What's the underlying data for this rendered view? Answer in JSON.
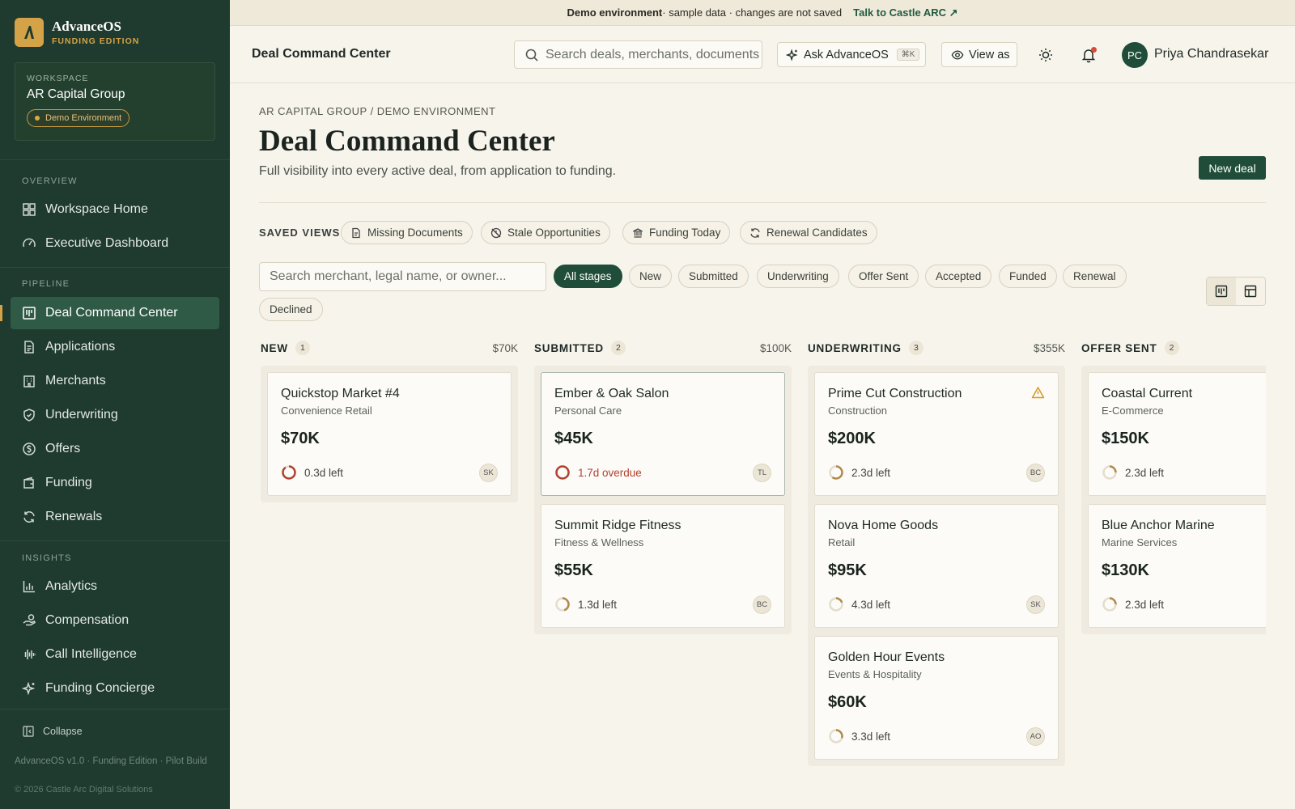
{
  "brand": {
    "name": "AdvanceOS",
    "edition": "FUNDING EDITION"
  },
  "workspace": {
    "label": "WORKSPACE",
    "name": "AR Capital Group",
    "badge": "Demo Environment"
  },
  "nav": {
    "sections": {
      "overview": "OVERVIEW",
      "pipeline": "PIPELINE",
      "insights": "INSIGHTS"
    },
    "items": {
      "workspace_home": "Workspace Home",
      "executive_dashboard": "Executive Dashboard",
      "deal_command_center": "Deal Command Center",
      "applications": "Applications",
      "merchants": "Merchants",
      "underwriting": "Underwriting",
      "offers": "Offers",
      "funding": "Funding",
      "renewals": "Renewals",
      "analytics": "Analytics",
      "compensation": "Compensation",
      "call_intelligence": "Call Intelligence",
      "funding_concierge": "Funding Concierge"
    },
    "collapse": "Collapse",
    "footer": "AdvanceOS v1.0 · Funding Edition · Pilot Build",
    "copyright": "© 2026 Castle Arc Digital Solutions"
  },
  "banner": {
    "strong": "Demo environment",
    "text": " · sample data · changes are not saved",
    "link": "Talk to Castle ARC ↗"
  },
  "topbar": {
    "title": "Deal Command Center",
    "search_placeholder": "Search deals, merchants, documents",
    "ask_label": "Ask AdvanceOS",
    "ask_shortcut": "⌘K",
    "view_as": "View as",
    "user_initials": "PC",
    "user_name": "Priya Chandrasekar"
  },
  "page": {
    "breadcrumb": "AR CAPITAL GROUP / DEMO ENVIRONMENT",
    "title": "Deal Command Center",
    "subtitle": "Full visibility into every active deal, from application to funding.",
    "new_deal": "New deal"
  },
  "saved_views": {
    "label": "SAVED VIEWS",
    "items": [
      "Missing Documents",
      "Stale Opportunities",
      "Funding Today",
      "Renewal Candidates"
    ]
  },
  "filters": {
    "search_placeholder": "Search merchant, legal name, or owner...",
    "stages": [
      "All stages",
      "New",
      "Submitted",
      "Underwriting",
      "Offer Sent",
      "Accepted",
      "Funded",
      "Renewal",
      "Declined"
    ],
    "active_stage": "All stages"
  },
  "colors": {
    "sidebar": "#1f3a2e",
    "accent": "#1f4d39",
    "gold": "#d4a247",
    "overdue": "#b2412f"
  },
  "board": {
    "columns": [
      {
        "title": "NEW",
        "count": "1",
        "total": "$70K",
        "cards": [
          {
            "name": "Quickstop Market #4",
            "category": "Convenience Retail",
            "amount": "$70K",
            "time": "0.3d left",
            "owner": "SK",
            "progress": 0.9,
            "status": "urgent"
          }
        ]
      },
      {
        "title": "SUBMITTED",
        "count": "2",
        "total": "$100K",
        "cards": [
          {
            "name": "Ember & Oak Salon",
            "category": "Personal Care",
            "amount": "$45K",
            "time": "1.7d overdue",
            "owner": "TL",
            "progress": 1.0,
            "status": "overdue"
          },
          {
            "name": "Summit Ridge Fitness",
            "category": "Fitness & Wellness",
            "amount": "$55K",
            "time": "1.3d left",
            "owner": "BC",
            "progress": 0.45,
            "status": "normal"
          }
        ]
      },
      {
        "title": "UNDERWRITING",
        "count": "3",
        "total": "$355K",
        "cards": [
          {
            "name": "Prime Cut Construction",
            "category": "Construction",
            "amount": "$200K",
            "time": "2.3d left",
            "owner": "BC",
            "progress": 0.6,
            "status": "warn"
          },
          {
            "name": "Nova Home Goods",
            "category": "Retail",
            "amount": "$95K",
            "time": "4.3d left",
            "owner": "SK",
            "progress": 0.2,
            "status": "normal"
          },
          {
            "name": "Golden Hour Events",
            "category": "Events & Hospitality",
            "amount": "$60K",
            "time": "3.3d left",
            "owner": "AO",
            "progress": 0.3,
            "status": "normal"
          }
        ]
      },
      {
        "title": "OFFER SENT",
        "count": "2",
        "total": "",
        "cards": [
          {
            "name": "Coastal Current",
            "category": "E-Commerce",
            "amount": "$150K",
            "time": "2.3d left",
            "owner": "",
            "progress": 0.25,
            "status": "normal"
          },
          {
            "name": "Blue Anchor Marine",
            "category": "Marine Services",
            "amount": "$130K",
            "time": "2.3d left",
            "owner": "",
            "progress": 0.25,
            "status": "normal"
          }
        ]
      }
    ]
  }
}
